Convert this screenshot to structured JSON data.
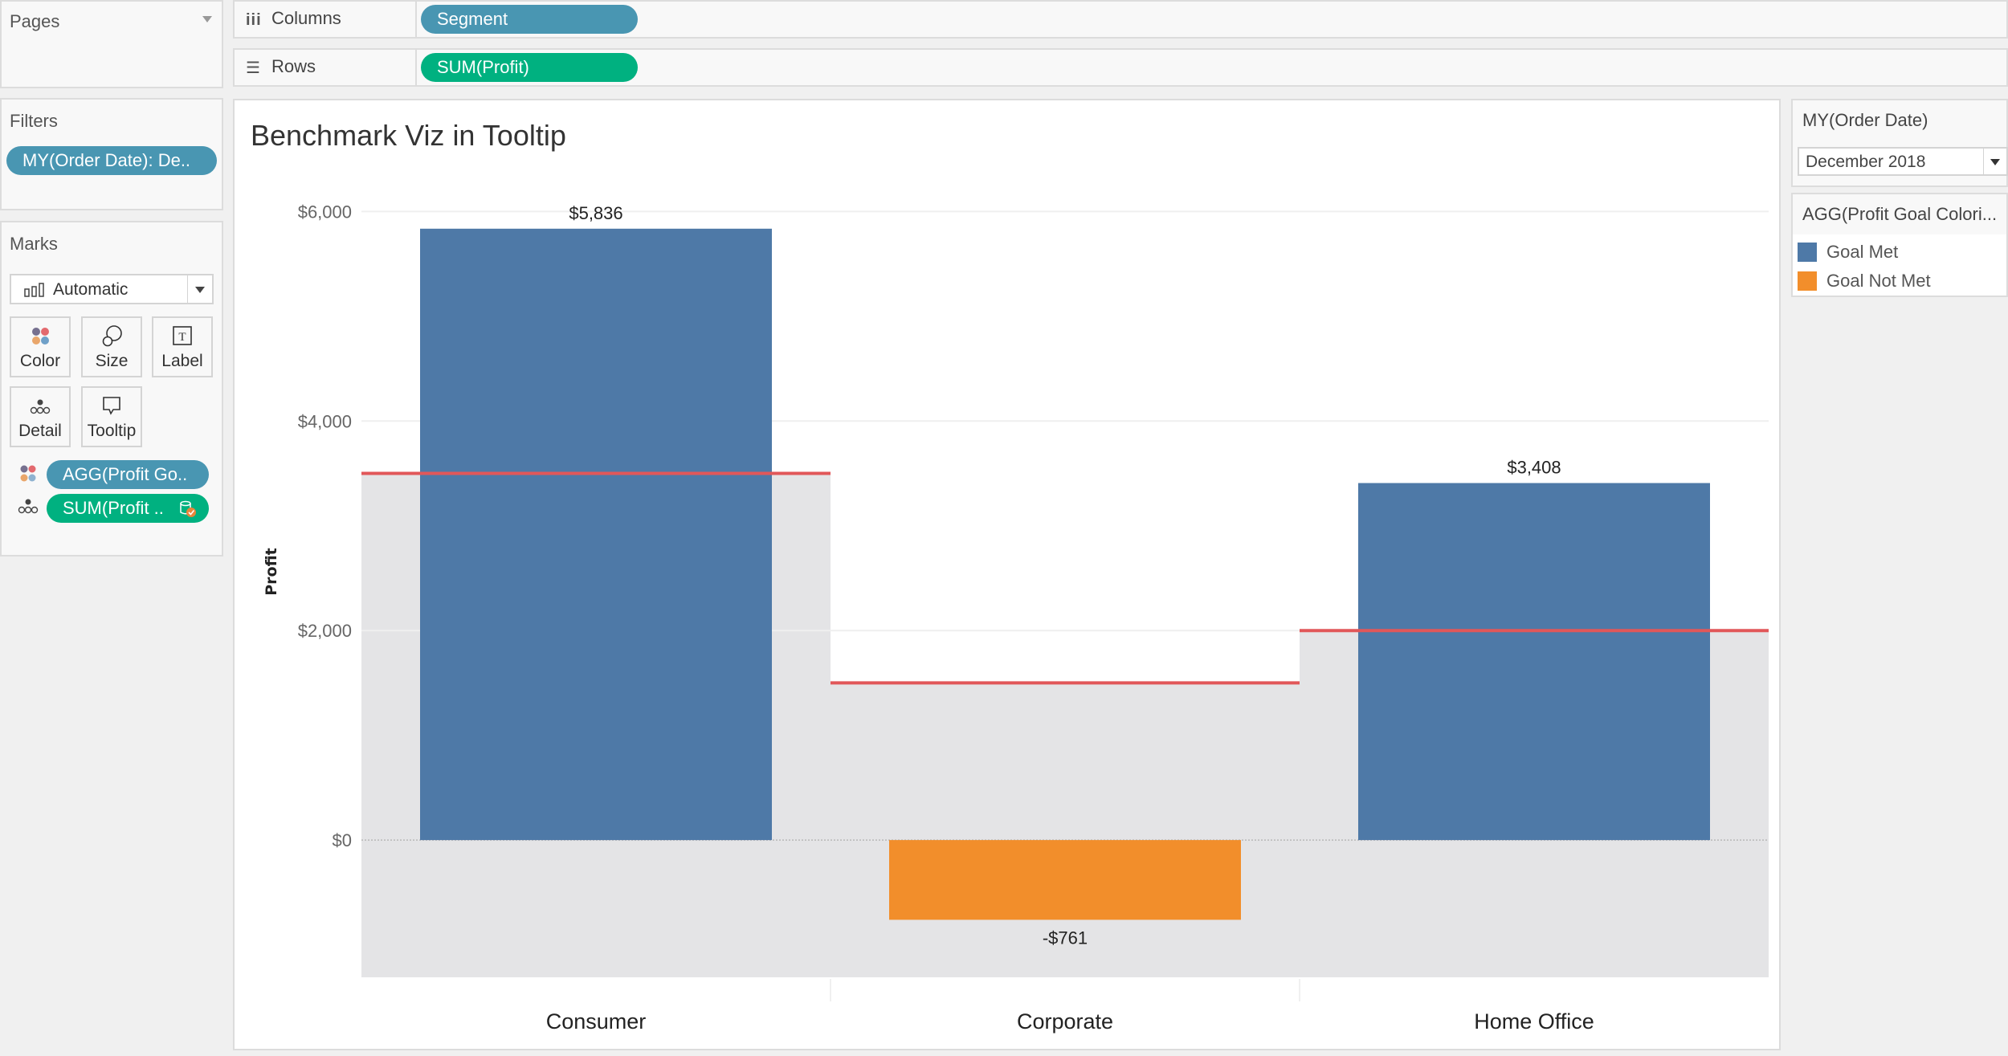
{
  "pages": {
    "title": "Pages"
  },
  "shelves": {
    "columns": {
      "label": "Columns",
      "pill": "Segment"
    },
    "rows": {
      "label": "Rows",
      "pill": "SUM(Profit)"
    }
  },
  "filters": {
    "title": "Filters",
    "items": [
      "MY(Order Date): De.."
    ]
  },
  "marks": {
    "title": "Marks",
    "type": "Automatic",
    "buttons": {
      "color": "Color",
      "size": "Size",
      "label": "Label",
      "detail": "Detail",
      "tooltip": "Tooltip"
    },
    "fields": [
      {
        "label": "AGG(Profit Go..",
        "encoding": "color"
      },
      {
        "label": "SUM(Profit ..",
        "encoding": "detail"
      }
    ]
  },
  "date_filter": {
    "title": "MY(Order Date)",
    "value": "December 2018"
  },
  "legend": {
    "title": "AGG(Profit Goal Colori...",
    "items": [
      {
        "label": "Goal Met",
        "color": "#4e79a7"
      },
      {
        "label": "Goal Not Met",
        "color": "#f28e2b"
      }
    ]
  },
  "colors": {
    "goal_met": "#4e79a7",
    "goal_not_met": "#f28e2b",
    "reference_line": "#e15759",
    "band": "#e4e4e6",
    "pill_blue": "#4996b2",
    "pill_green": "#00b180"
  },
  "chart_data": {
    "type": "bar",
    "title": "Benchmark Viz in Tooltip",
    "xlabel": "",
    "ylabel": "Profit",
    "categories": [
      "Consumer",
      "Corporate",
      "Home Office"
    ],
    "values": [
      5836,
      -761,
      3408
    ],
    "data_labels": [
      "$5,836",
      "-$761",
      "$3,408"
    ],
    "bar_status": [
      "Goal Met",
      "Goal Not Met",
      "Goal Met"
    ],
    "reference_lines": [
      3500,
      1500,
      2000
    ],
    "reference_band_to_line": true,
    "yticks": [
      0,
      2000,
      4000,
      6000
    ],
    "ytick_labels": [
      "$0",
      "$2,000",
      "$4,000",
      "$6,000"
    ],
    "ylim": [
      -1310,
      6440
    ],
    "grid": true,
    "legend_position": "right"
  }
}
